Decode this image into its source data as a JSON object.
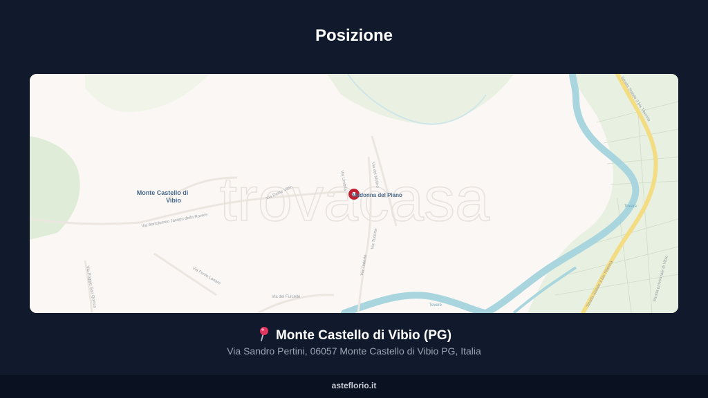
{
  "header": {
    "title": "Posizione"
  },
  "map": {
    "place_labels": {
      "town_line1": "Monte Castello di",
      "town_line2": "Vibio",
      "marker_label": "Madonna del Piano"
    },
    "road_labels": {
      "bartolomeo": "Via Bartolomeo Jacopo della Rovere",
      "dante": "Via Dante Vibio",
      "molino": "Via del Molino",
      "tuderte_1": "Via Tuderte",
      "tuderte_2": "Via Tuderte",
      "umbria": "Via Umbria",
      "furcelle": "Via del Furcelle",
      "fonte": "Via Fonte Lanare",
      "poggio": "Via Poggio San Quirico",
      "ss3_1": "Strada Statale 3 bis Tiberina",
      "ss3_2": "Strada Statale 3 bis Tiberina",
      "sp": "Strada provinciale di Vibio",
      "tevere_1": "Tevere",
      "tevere_2": "Tevere"
    },
    "watermark": "trovacasa",
    "colors": {
      "land": "#fbf7f4",
      "water": "#a9d6de",
      "green": "#dcebd5",
      "highway": "#f3dc82"
    }
  },
  "location": {
    "pin_icon": "round-pushpin-icon",
    "name": "Monte Castello di Vibio (PG)",
    "address": "Via Sandro Pertini, 06057 Monte Castello di Vibio PG, Italia"
  },
  "footer": {
    "site": "asteflorio.it"
  }
}
